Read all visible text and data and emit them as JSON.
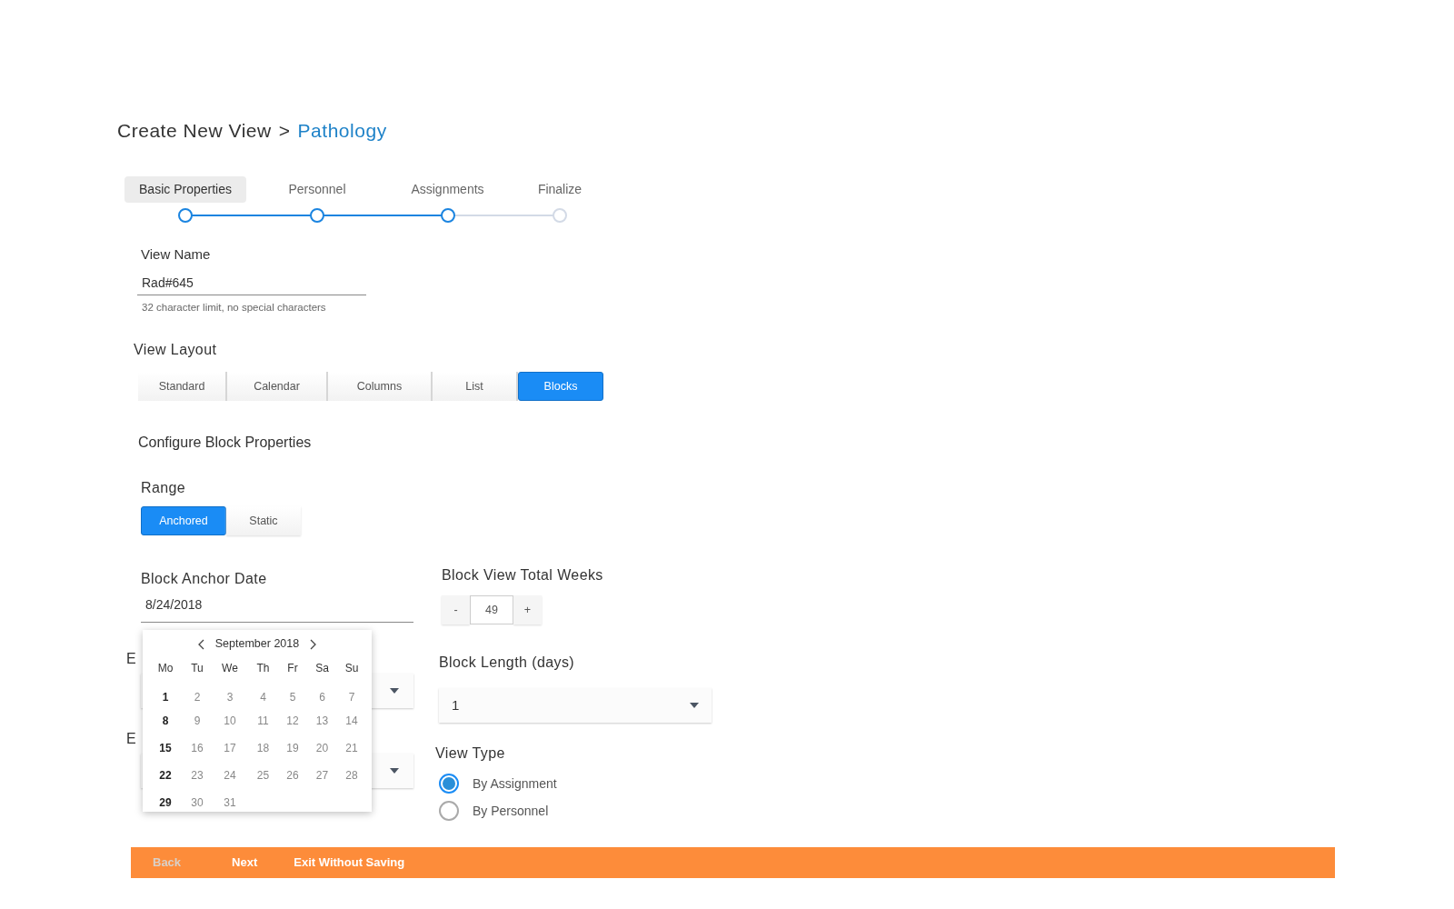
{
  "breadcrumb": {
    "parent": "Create New View",
    "separator": ">",
    "current": "Pathology"
  },
  "steps": [
    {
      "label": "Basic Properties",
      "selected": true,
      "reached": true
    },
    {
      "label": "Personnel",
      "selected": false,
      "reached": true
    },
    {
      "label": "Assignments",
      "selected": false,
      "reached": true
    },
    {
      "label": "Finalize",
      "selected": false,
      "reached": false
    }
  ],
  "view_name": {
    "label": "View Name",
    "value": "Rad#645",
    "hint": "32 character limit, no special characters"
  },
  "view_layout": {
    "label": "View Layout",
    "options": [
      {
        "label": "Standard",
        "selected": false
      },
      {
        "label": "Calendar",
        "selected": false
      },
      {
        "label": "Columns",
        "selected": false
      },
      {
        "label": "List",
        "selected": false
      },
      {
        "label": "Blocks",
        "selected": true
      }
    ]
  },
  "section_title": "Configure Block Properties",
  "range": {
    "label": "Range",
    "options": [
      {
        "label": "Anchored",
        "selected": true
      },
      {
        "label": "Static",
        "selected": false
      }
    ]
  },
  "anchor_date": {
    "label": "Block Anchor Date",
    "value": "8/24/2018"
  },
  "hidden_fields": [
    {
      "label": "E"
    },
    {
      "label": "E"
    }
  ],
  "calendar": {
    "month": "September 2018",
    "weekdays": [
      "Mo",
      "Tu",
      "We",
      "Th",
      "Fr",
      "Sa",
      "Su"
    ],
    "weeks": [
      [
        "1",
        "2",
        "3",
        "4",
        "5",
        "6",
        "7"
      ],
      [
        "8",
        "9",
        "10",
        "11",
        "12",
        "13",
        "14"
      ],
      [
        "15",
        "16",
        "17",
        "18",
        "19",
        "20",
        "21"
      ],
      [
        "22",
        "23",
        "24",
        "25",
        "26",
        "27",
        "28"
      ],
      [
        "29",
        "30",
        "31"
      ]
    ]
  },
  "total_weeks": {
    "label": "Block View Total Weeks",
    "minus": "-",
    "value": "49",
    "plus": "+"
  },
  "block_length": {
    "label": "Block Length (days)",
    "value": "1"
  },
  "view_type": {
    "label": "View Type",
    "options": [
      {
        "label": "By Assignment",
        "selected": true
      },
      {
        "label": "By Personnel",
        "selected": false
      }
    ]
  },
  "footer": [
    {
      "label": "Back",
      "disabled": true
    },
    {
      "label": "Next",
      "disabled": false
    },
    {
      "label": "Exit Without Saving",
      "disabled": false
    }
  ]
}
